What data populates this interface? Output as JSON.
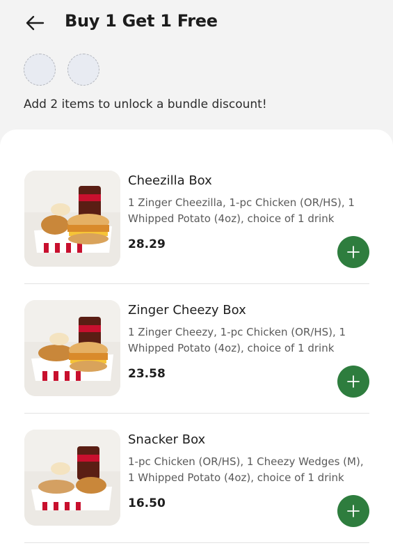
{
  "header": {
    "title": "Buy 1 Get 1 Free",
    "back_icon": "arrow-left-icon",
    "hint": "Add 2 items to unlock a bundle discount!"
  },
  "colors": {
    "accent": "#2e7d3e",
    "page_bg": "#f3f3f3",
    "sheet_bg": "#ffffff",
    "slot_bg": "#e8ebf2"
  },
  "items": [
    {
      "name": "Cheezilla Box",
      "description": "1 Zinger Cheezilla, 1-pc Chicken (OR/HS), 1 Whipped Potato (4oz), choice of 1 drink",
      "price": "28.29",
      "add_icon": "plus-icon"
    },
    {
      "name": "Zinger Cheezy Box",
      "description": "1 Zinger Cheezy, 1-pc Chicken (OR/HS), 1 Whipped Potato (4oz), choice of 1 drink",
      "price": "23.58",
      "add_icon": "plus-icon"
    },
    {
      "name": "Snacker Box",
      "description": "1-pc Chicken (OR/HS), 1 Cheezy Wedges (M), 1 Whipped Potato (4oz), choice of 1 drink",
      "price": "16.50",
      "add_icon": "plus-icon"
    }
  ]
}
